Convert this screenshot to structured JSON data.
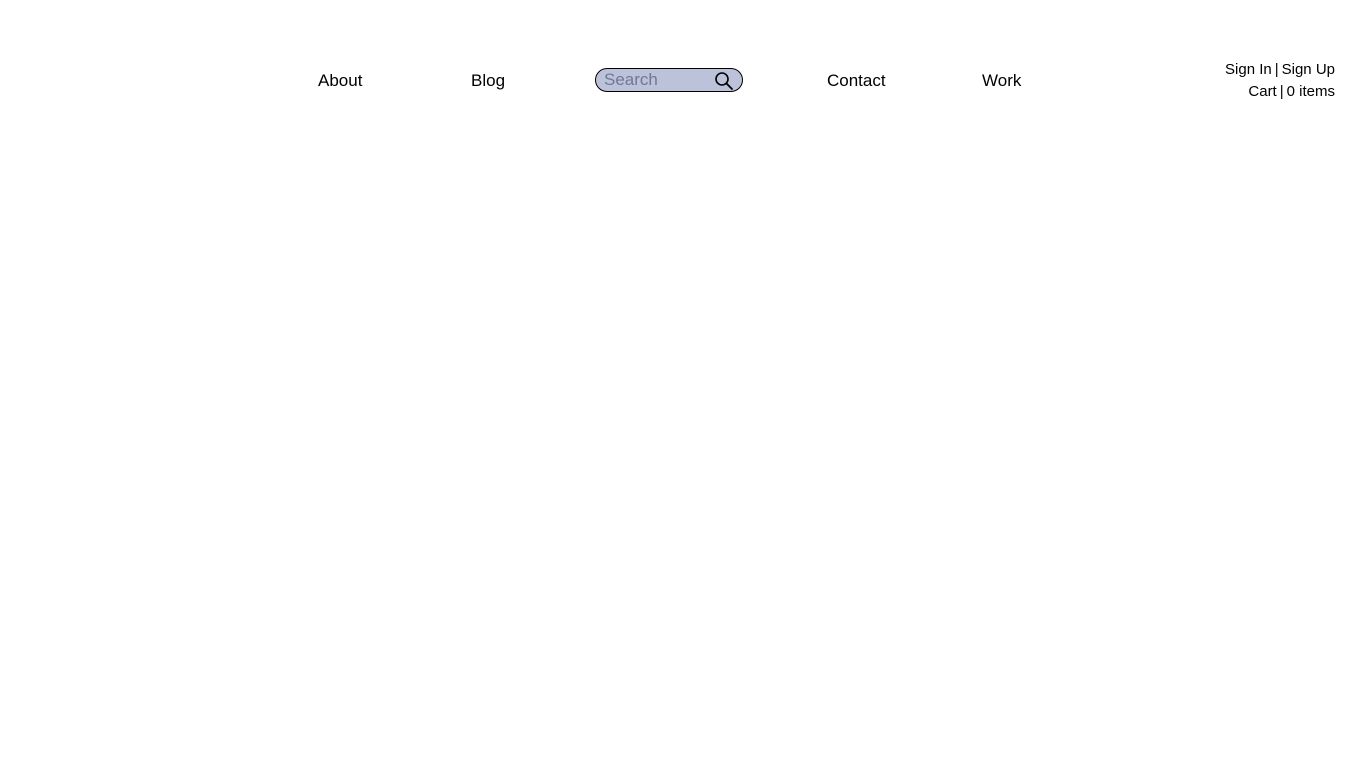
{
  "nav": {
    "items": [
      {
        "label": "About"
      },
      {
        "label": "Blog"
      },
      {
        "label": "Contact"
      },
      {
        "label": "Work"
      }
    ],
    "search": {
      "placeholder": "Search",
      "value": "",
      "icon": "magnifier"
    }
  },
  "account": {
    "sign_in": "Sign In",
    "sign_up": "Sign Up",
    "separator": "|",
    "cart_label": "Cart",
    "cart_items": "0 items"
  },
  "colors": {
    "search_background": "#bcc2da",
    "search_border": "#000000",
    "text": "#000000",
    "background": "#ffffff"
  }
}
